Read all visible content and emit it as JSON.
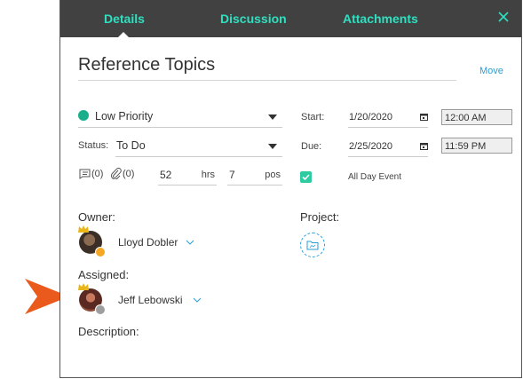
{
  "tabs": [
    {
      "label": "Details",
      "active": true
    },
    {
      "label": "Discussion",
      "active": false
    },
    {
      "label": "Attachments",
      "active": false
    }
  ],
  "title": "Reference Topics",
  "move_label": "Move",
  "priority": {
    "value": "Low Priority",
    "color": "#1aae8b"
  },
  "status": {
    "label": "Status:",
    "value": "To Do"
  },
  "start": {
    "label": "Start:",
    "date": "1/20/2020",
    "time": "12:00 AM"
  },
  "due": {
    "label": "Due:",
    "date": "2/25/2020",
    "time": "11:59 PM"
  },
  "counts": {
    "notes": "(0)",
    "attachments": "(0)"
  },
  "hours": {
    "value": "52",
    "unit": "hrs"
  },
  "pos": {
    "value": "7",
    "unit": "pos"
  },
  "all_day": {
    "label": "All Day Event",
    "checked": true
  },
  "owner": {
    "label": "Owner:",
    "name": "Lloyd Dobler",
    "status_color": "#f5a623"
  },
  "project": {
    "label": "Project:"
  },
  "assigned": {
    "label": "Assigned:",
    "name": "Jeff Lebowski",
    "status_color": "#9e9e9e"
  },
  "description": {
    "label": "Description:"
  },
  "colors": {
    "accent": "#2ee0c0",
    "link": "#2a9fd6",
    "header_bg": "#414141",
    "pointer": "#ea5a1c"
  }
}
